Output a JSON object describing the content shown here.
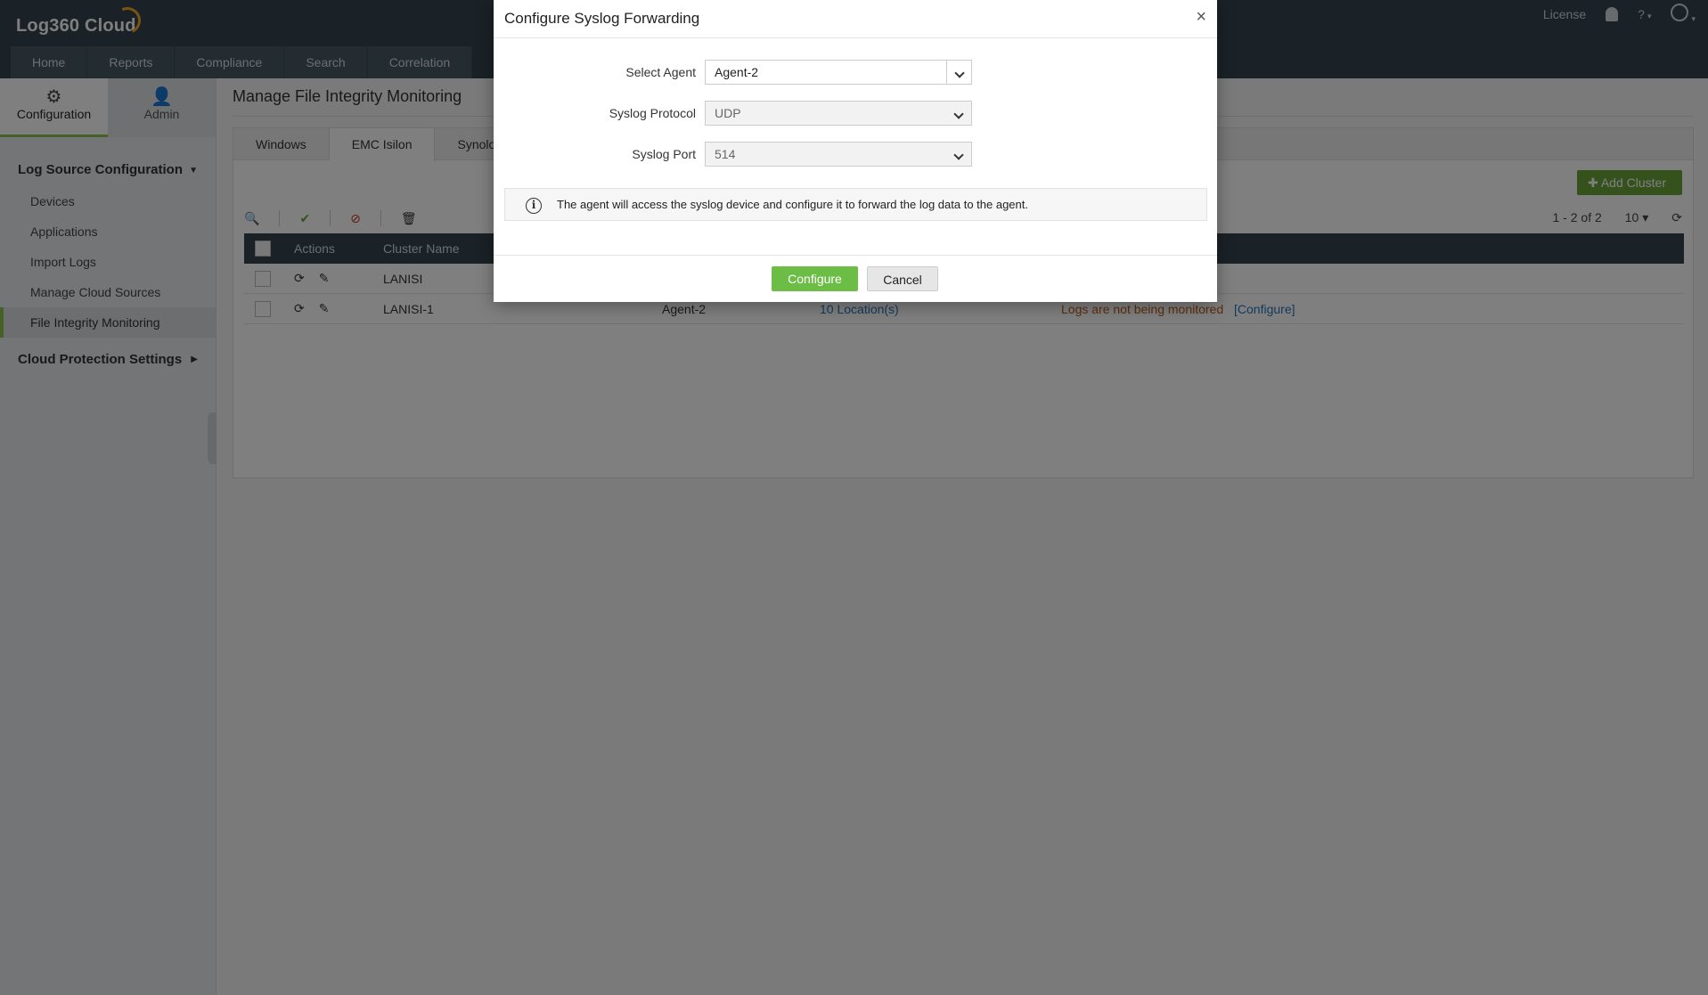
{
  "app": {
    "logo_text": "Log360 Cloud",
    "license_label": "License",
    "help_icon": "question-icon",
    "notification_icon": "bell-icon",
    "user_icon": "user-circle-icon"
  },
  "main_nav": [
    {
      "label": "Home"
    },
    {
      "label": "Reports"
    },
    {
      "label": "Compliance"
    },
    {
      "label": "Search"
    },
    {
      "label": "Correlation"
    }
  ],
  "sidebar": {
    "tabs": [
      {
        "label": "Configuration",
        "icon": "gear-icon",
        "active": true
      },
      {
        "label": "Admin",
        "icon": "user-icon",
        "active": false
      }
    ],
    "section1": "Log Source Configuration",
    "items": [
      {
        "label": "Devices"
      },
      {
        "label": "Applications"
      },
      {
        "label": "Import Logs"
      },
      {
        "label": "Manage Cloud Sources"
      },
      {
        "label": "File Integrity Monitoring",
        "active": true
      }
    ],
    "section2": "Cloud Protection Settings"
  },
  "page": {
    "title": "Manage File Integrity Monitoring",
    "tabs": [
      {
        "label": "Windows"
      },
      {
        "label": "EMC Isilon",
        "active": true
      },
      {
        "label": "Synolo"
      }
    ],
    "add_cluster_label": "Add Cluster",
    "pagination": "1 - 2 of 2",
    "page_size": "10",
    "table": {
      "headers": {
        "actions": "Actions",
        "cluster_name": "Cluster Name"
      },
      "rows": [
        {
          "name": "LANISI",
          "agent": "",
          "locations": "",
          "status": "",
          "status_link": ""
        },
        {
          "name": "LANISI-1",
          "agent": "Agent-2",
          "locations": "10 Location(s)",
          "status": "Logs are not being monitored",
          "status_link": "[Configure]"
        }
      ]
    }
  },
  "modal": {
    "title": "Configure Syslog Forwarding",
    "fields": {
      "agent": {
        "label": "Select Agent",
        "value": "Agent-2"
      },
      "protocol": {
        "label": "Syslog Protocol",
        "value": "UDP"
      },
      "port": {
        "label": "Syslog Port",
        "value": "514"
      }
    },
    "info_text": "The agent will access the syslog device and configure it to forward the log data to the agent.",
    "configure_label": "Configure",
    "cancel_label": "Cancel",
    "colors": {
      "primary_button": "#6cbd45"
    }
  }
}
